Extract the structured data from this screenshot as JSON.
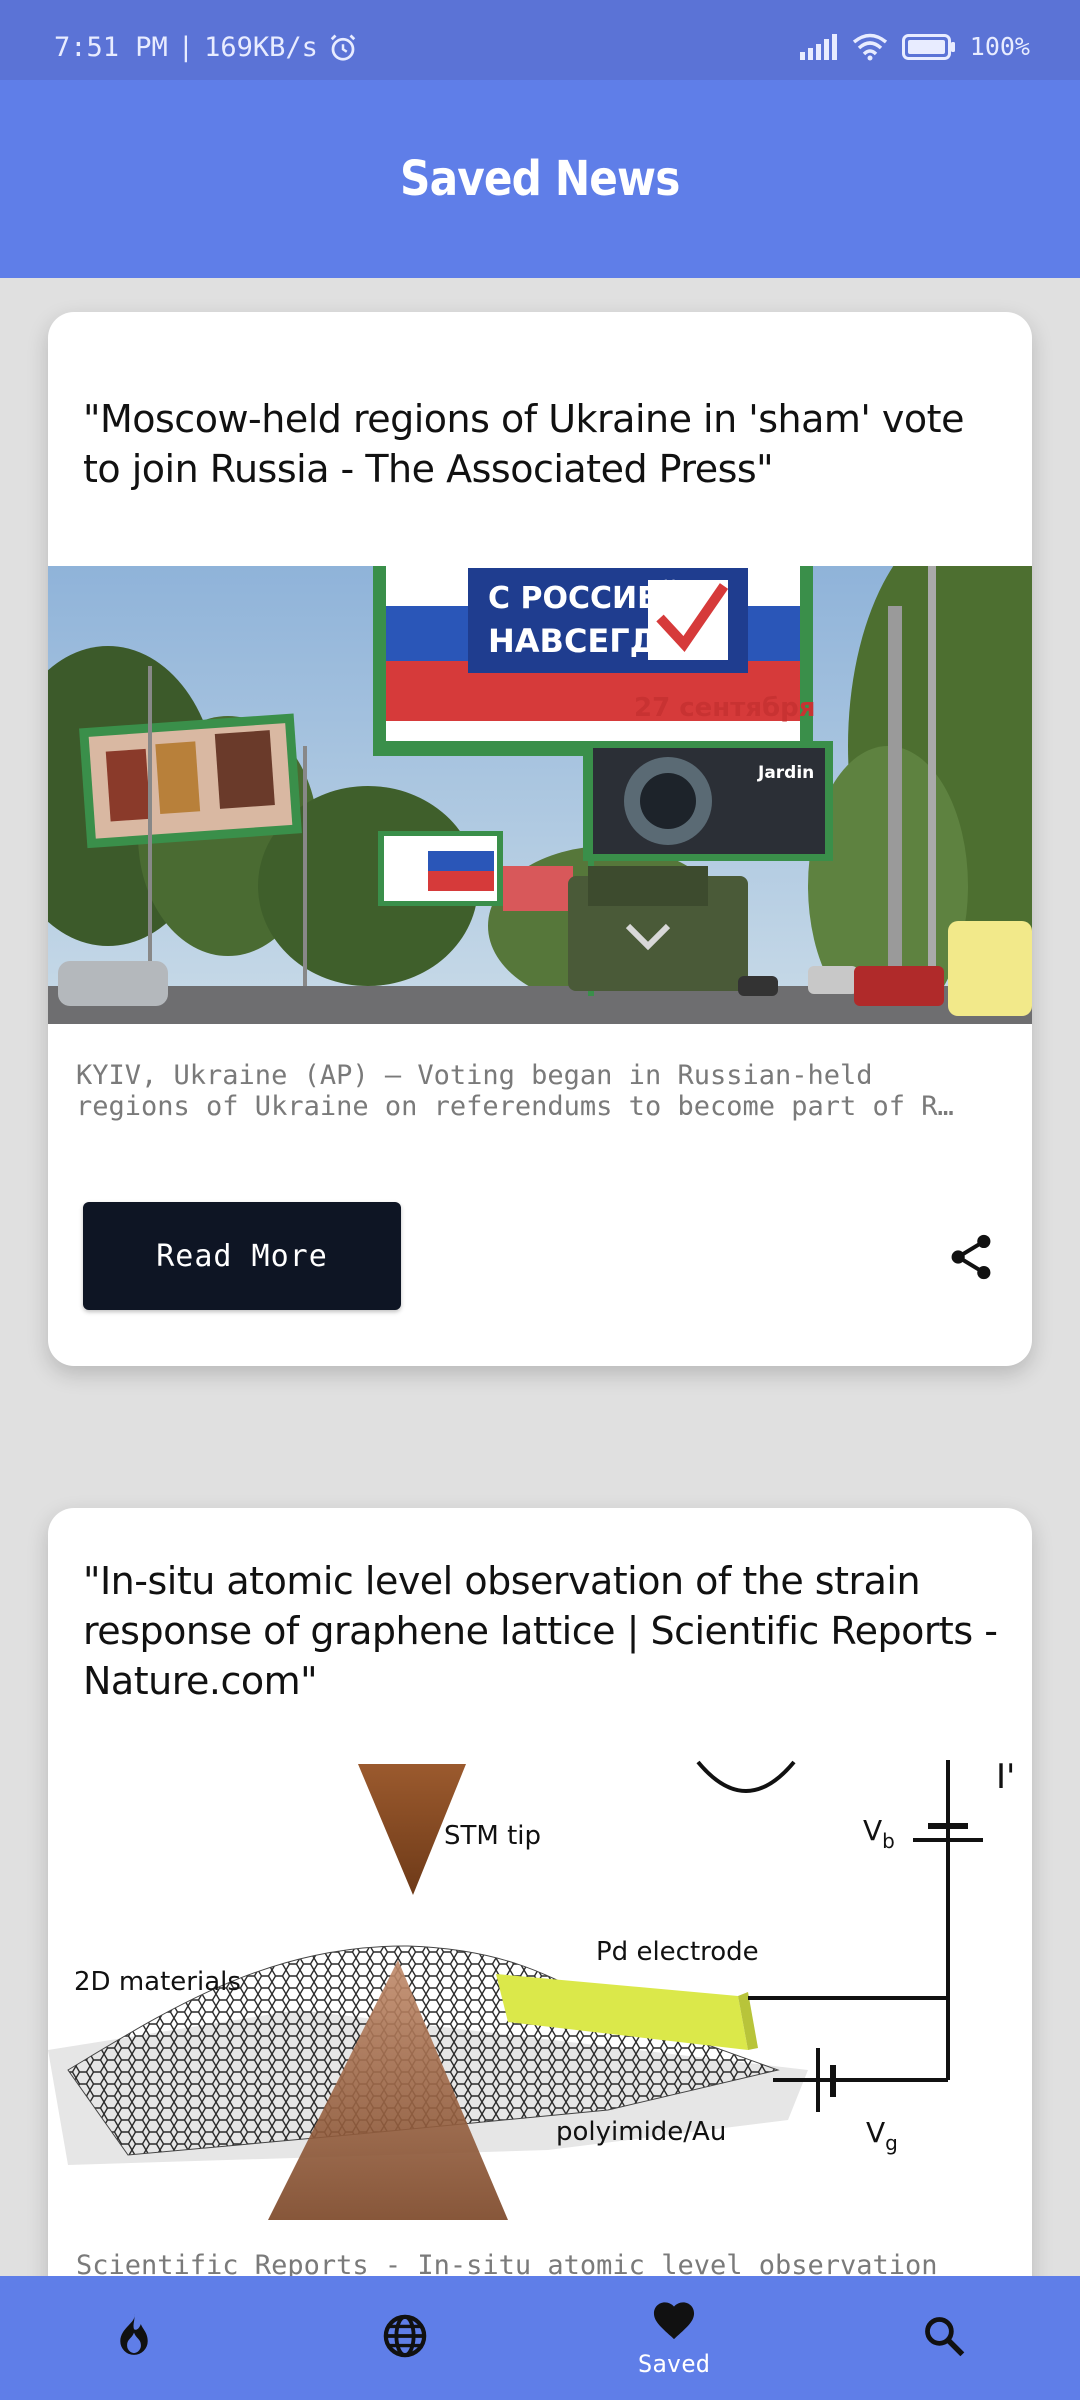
{
  "status_bar": {
    "time": "7:51 PM",
    "separator": "|",
    "speed": "169KB/s",
    "battery": "100%"
  },
  "app_bar": {
    "title": "Saved News"
  },
  "articles": [
    {
      "title": "\"Moscow-held regions of Ukraine in 'sham' vote to join Russia - The Associated Press\"",
      "description_line1": "KYIV, Ukraine (AP) — Voting began in Russian-held",
      "description_line2": "regions of Ukraine on referendums to become part of R…",
      "image": {
        "billboard_line1": "С РОССИЕЙ",
        "billboard_line2": "НАВСЕГДА!",
        "billboard_date": "27 сентября",
        "ad_brand": "Jardin"
      },
      "read_more_label": "Read More"
    },
    {
      "title": "\"In-situ atomic level observation of the strain response of graphene lattice | Scientific Reports - Nature.com\"",
      "description_line1": "Scientific Reports - In-situ atomic level observation",
      "image": {
        "label_tip": "STM tip",
        "label_materials": "2D materials",
        "label_electrode": "Pd electrode",
        "label_substrate": "polyimide/Au",
        "label_vb": "V",
        "label_vb_sub": "b",
        "label_vg": "V",
        "label_vg_sub": "g",
        "label_i": "I'"
      }
    }
  ],
  "bottom_nav": {
    "items": [
      {
        "icon": "flame-icon"
      },
      {
        "icon": "globe-icon"
      },
      {
        "icon": "heart-icon",
        "label": "Saved"
      },
      {
        "icon": "search-icon"
      }
    ]
  },
  "colors": {
    "status_bar": "#5b73d6",
    "app_bar": "#5f7ee8",
    "background": "#e0e0e0",
    "button": "#0e1524"
  }
}
